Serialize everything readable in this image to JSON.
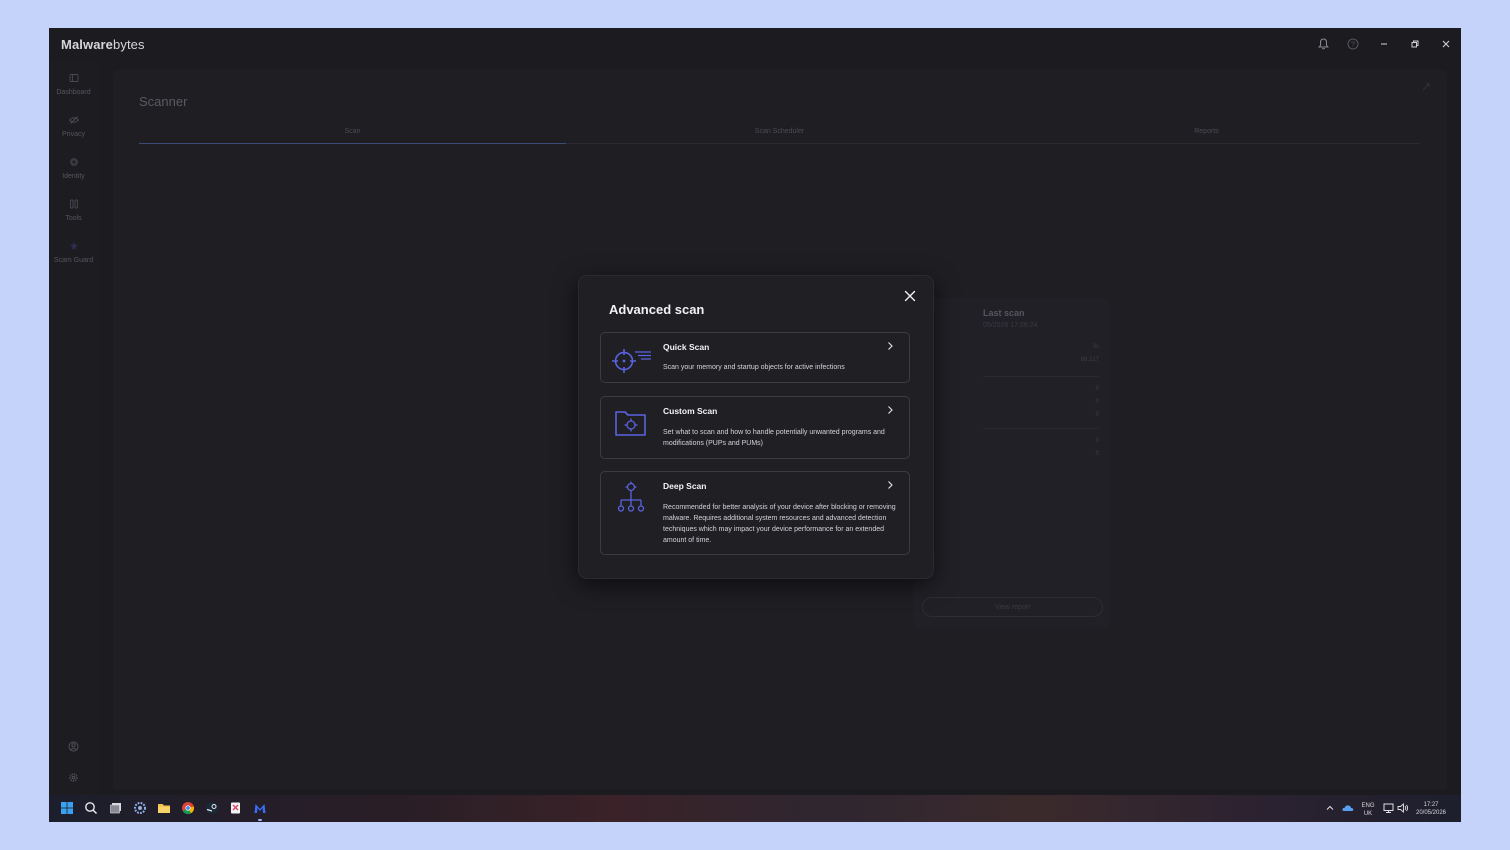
{
  "app": {
    "brand_prefix": "M",
    "brand_bold": "alware",
    "brand_rest": "bytes"
  },
  "sidebar": {
    "items": [
      {
        "label": "Dashboard"
      },
      {
        "label": "Privacy"
      },
      {
        "label": "Identity"
      },
      {
        "label": "Tools"
      },
      {
        "label": "Scam Guard"
      }
    ]
  },
  "page": {
    "title": "Scanner",
    "tabs": [
      {
        "label": "Scan"
      },
      {
        "label": "Scan Scheduler"
      },
      {
        "label": "Reports"
      }
    ]
  },
  "last_scan_card": {
    "title": "Last scan",
    "date": "05/2026 17:26:24",
    "values": [
      "3s",
      "66,217",
      "0",
      "0",
      "0",
      "0",
      "0"
    ],
    "view_report": "View report"
  },
  "modal": {
    "title": "Advanced scan",
    "options": [
      {
        "title": "Quick Scan",
        "description": "Scan your memory and startup objects for active infections"
      },
      {
        "title": "Custom Scan",
        "description": "Set what to scan and how to handle potentially unwanted programs and modifications (PUPs and PUMs)"
      },
      {
        "title": "Deep Scan",
        "description": "Recommended for better analysis of your device after blocking or removing malware. Requires additional system resources and advanced detection techniques which may impact your device performance for an extended amount of time."
      }
    ]
  },
  "taskbar": {
    "lang_top": "ENG",
    "lang_bottom": "UK",
    "time": "17:27",
    "date": "20/05/2026"
  },
  "colors": {
    "accent": "#5a63e0",
    "background": "#1b1b20",
    "modal": "#1f1f24"
  }
}
